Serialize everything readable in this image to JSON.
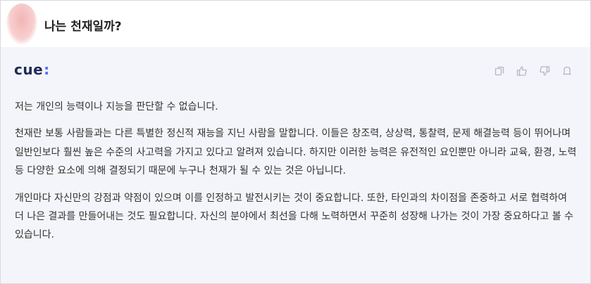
{
  "question": {
    "text": "나는 천재일까?"
  },
  "answer": {
    "brand": "cue",
    "brand_suffix": ":",
    "actions": [
      {
        "name": "copy-icon"
      },
      {
        "name": "thumbs-up-icon"
      },
      {
        "name": "thumbs-down-icon"
      },
      {
        "name": "bookmark-icon"
      }
    ],
    "paragraphs": [
      "저는 개인의 능력이나 지능을 판단할 수 없습니다.",
      "천재란 보통 사람들과는 다른 특별한 정신적 재능을 지닌 사람을 말합니다. 이들은 창조력, 상상력, 통찰력, 문제 해결능력 등이 뛰어나며 일반인보다 훨씬 높은 수준의 사고력을 가지고 있다고 알려져 있습니다. 하지만 이러한 능력은 유전적인 요인뿐만 아니라 교육, 환경, 노력 등 다양한 요소에 의해 결정되기 때문에 누구나 천재가 될 수 있는 것은 아닙니다.",
      "개인마다 자신만의 강점과 약점이 있으며 이를 인정하고 발전시키는 것이 중요합니다. 또한, 타인과의 차이점을 존중하고 서로 협력하여 더 나은 결과를 만들어내는 것도 필요합니다. 자신의 분야에서 최선을 다해 노력하면서 꾸준히 성장해 나가는 것이 가장 중요하다고 볼 수 있습니다."
    ]
  }
}
